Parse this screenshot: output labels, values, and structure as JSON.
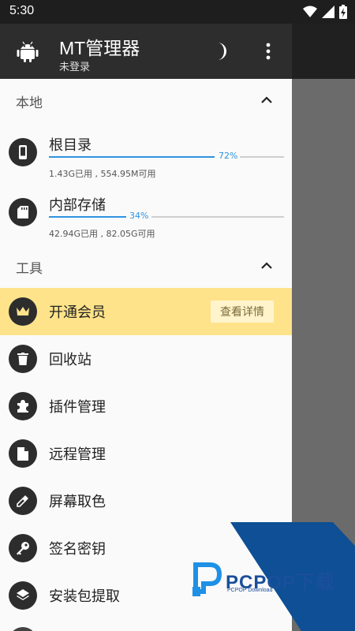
{
  "status_bar": {
    "time": "5:30"
  },
  "header": {
    "title": "MT管理器",
    "subtitle": "未登录",
    "icons": [
      "android-icon",
      "moon-icon",
      "more-vert-icon"
    ]
  },
  "local_section": {
    "title": "本地",
    "items": [
      {
        "name": "根目录",
        "percent": 72,
        "percent_label": "72%",
        "detail": "1.43G已用 , 554.95M可用",
        "icon": "phone-icon"
      },
      {
        "name": "内部存储",
        "percent": 34,
        "percent_label": "34%",
        "detail": "42.94G已用 , 82.05G可用",
        "icon": "sd-card-icon"
      }
    ]
  },
  "tools_section": {
    "title": "工具",
    "vip": {
      "label": "开通会员",
      "button": "查看详情",
      "icon": "crown-icon"
    },
    "items": [
      {
        "label": "回收站",
        "icon": "trash-icon"
      },
      {
        "label": "插件管理",
        "icon": "puzzle-icon"
      },
      {
        "label": "远程管理",
        "icon": "file-icon"
      },
      {
        "label": "屏幕取色",
        "icon": "eyedropper-icon"
      },
      {
        "label": "签名密钥",
        "icon": "key-icon"
      },
      {
        "label": "安装包提取",
        "icon": "layers-icon"
      }
    ]
  },
  "watermark": {
    "title": "PCPOP下载",
    "subtitle": "PCPOP Download"
  },
  "colors": {
    "header": "#2d2d2d",
    "accent": "#2f93e0",
    "vip": "#ffe38a"
  }
}
